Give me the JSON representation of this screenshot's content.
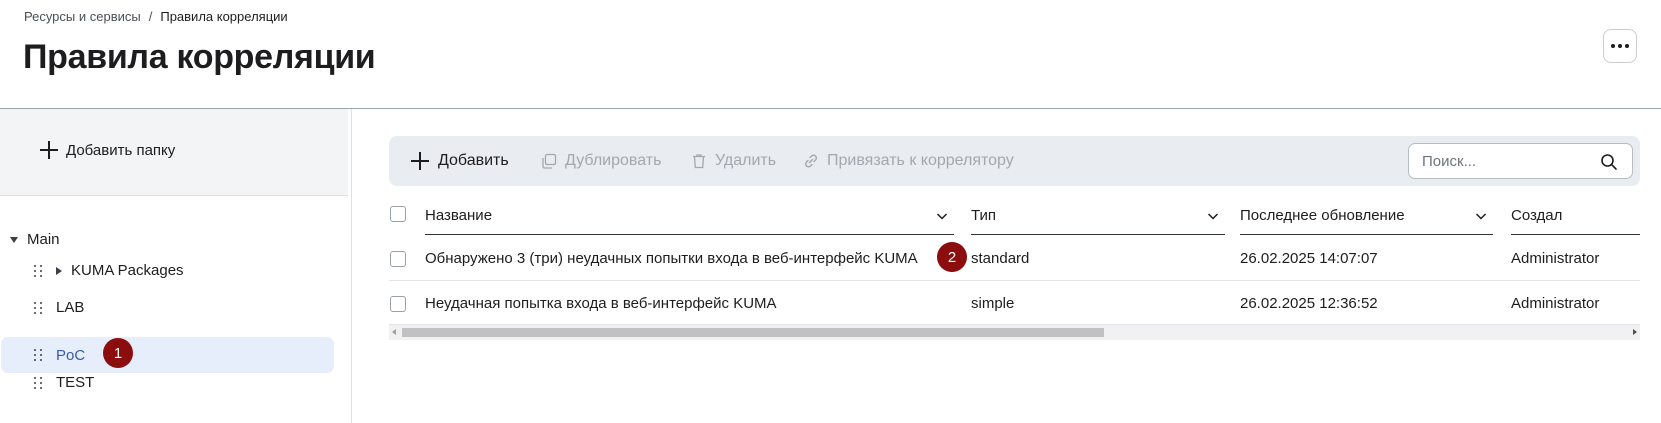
{
  "breadcrumb": {
    "parent": "Ресурсы и сервисы",
    "separator": "/",
    "current": "Правила корреляции"
  },
  "page_title": "Правила корреляции",
  "sidebar": {
    "add_folder_label": "Добавить папку",
    "root": {
      "label": "Main",
      "expanded": true
    },
    "items": [
      {
        "label": "KUMA Packages",
        "has_children": true,
        "selected": false
      },
      {
        "label": "LAB",
        "has_children": false,
        "selected": false
      },
      {
        "label": "PoC",
        "has_children": false,
        "selected": true
      },
      {
        "label": "TEST",
        "has_children": false,
        "selected": false
      }
    ]
  },
  "toolbar": {
    "add_label": "Добавить",
    "duplicate_label": "Дублировать",
    "delete_label": "Удалить",
    "bind_label": "Привязать к коррелятору",
    "search_placeholder": "Поиск..."
  },
  "table": {
    "columns": [
      "Название",
      "Тип",
      "Последнее обновление",
      "Создал"
    ],
    "rows": [
      {
        "name": "Обнаружено 3 (три) неудачных попытки входа в веб-интерфейс KUMA",
        "type": "standard",
        "updated": "26.02.2025 14:07:07",
        "author": "Administrator"
      },
      {
        "name": "Неудачная попытка входа в веб-интерфейс KUMA",
        "type": "simple",
        "updated": "26.02.2025 12:36:52",
        "author": "Administrator"
      }
    ]
  },
  "markers": [
    "1",
    "2"
  ],
  "colors": {
    "accent": "#3c5ba5",
    "marker": "#8b0d0d",
    "selected_bg": "#e7eefb",
    "toolbar_bg": "#e9ecf0"
  },
  "horizontal_scroll": {
    "visible_fraction": 0.57
  }
}
